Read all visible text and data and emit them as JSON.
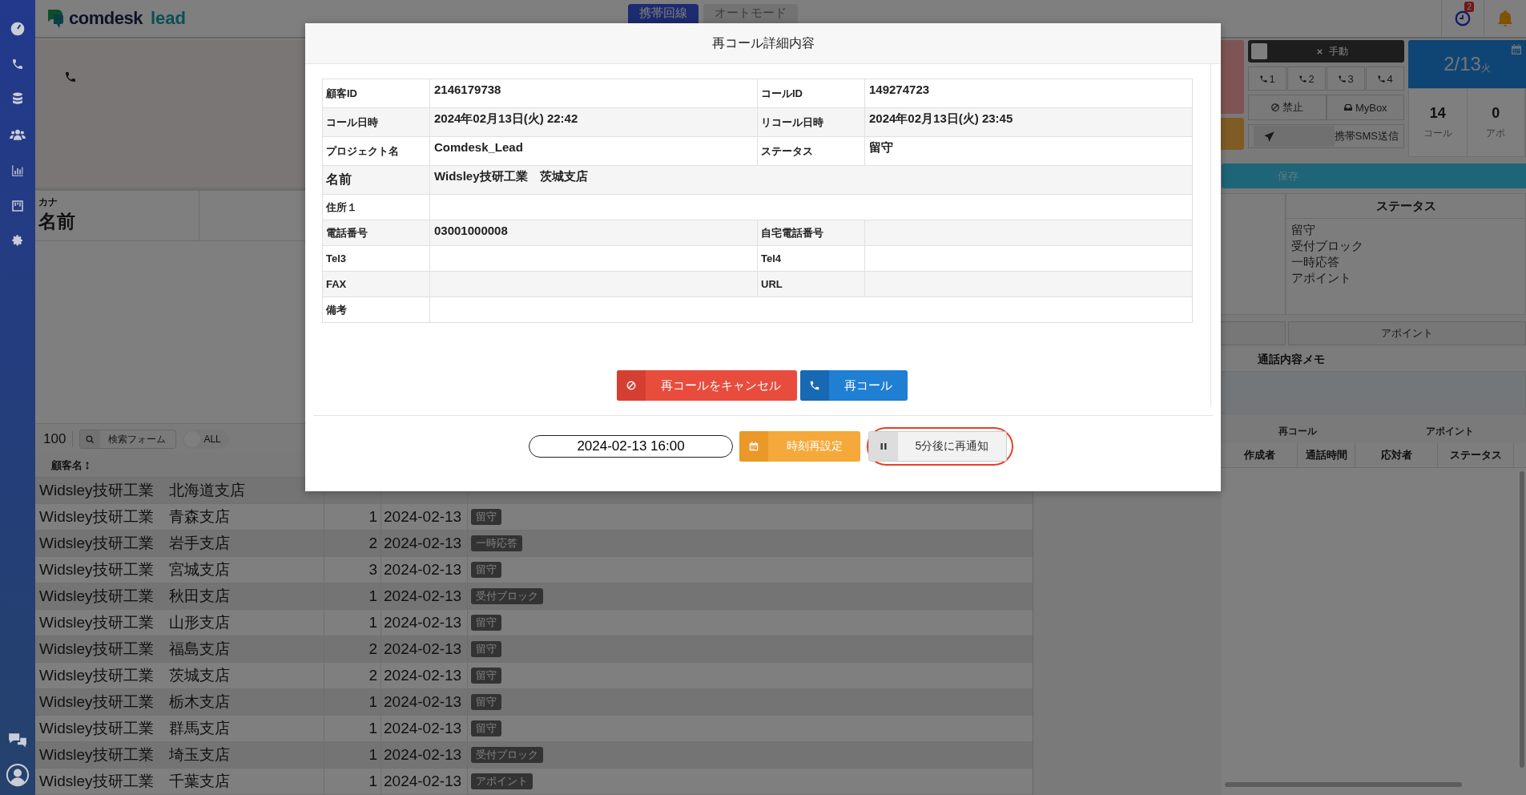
{
  "header": {
    "logo": {
      "brand": "comdesk",
      "product": "lead"
    },
    "tabs": [
      {
        "label": "携帯回線",
        "selected": true
      },
      {
        "label": "オートモード",
        "selected": false
      }
    ],
    "history_badge": "2"
  },
  "contact": {
    "kana_label": "カナ",
    "name_label": "名前"
  },
  "list": {
    "page_size": "100",
    "search_button": "検索フォーム",
    "toggle": {
      "label": "ALL",
      "on": false
    },
    "column": "顧客名",
    "rows": [
      {
        "name": "Widsley技研工業　北海道支店"
      },
      {
        "name": "Widsley技研工業　青森支店",
        "count": "1",
        "date": "2024-02-13",
        "status": "留守"
      },
      {
        "name": "Widsley技研工業　岩手支店",
        "count": "2",
        "date": "2024-02-13",
        "status": "一時応答"
      },
      {
        "name": "Widsley技研工業　宮城支店",
        "count": "3",
        "date": "2024-02-13",
        "status": "留守"
      },
      {
        "name": "Widsley技研工業　秋田支店",
        "count": "1",
        "date": "2024-02-13",
        "status": "受付ブロック"
      },
      {
        "name": "Widsley技研工業　山形支店",
        "count": "1",
        "date": "2024-02-13",
        "status": "留守"
      },
      {
        "name": "Widsley技研工業　福島支店",
        "count": "2",
        "date": "2024-02-13",
        "status": "留守"
      },
      {
        "name": "Widsley技研工業　茨城支店",
        "count": "2",
        "date": "2024-02-13",
        "status": "留守"
      },
      {
        "name": "Widsley技研工業　栃木支店",
        "count": "1",
        "date": "2024-02-13",
        "status": "留守"
      },
      {
        "name": "Widsley技研工業　群馬支店",
        "count": "1",
        "date": "2024-02-13",
        "status": "留守"
      },
      {
        "name": "Widsley技研工業　埼玉支店",
        "count": "1",
        "date": "2024-02-13",
        "status": "受付ブロック"
      },
      {
        "name": "Widsley技研工業　千葉支店",
        "count": "1",
        "date": "2024-02-13",
        "status": "アポイント"
      }
    ]
  },
  "dialer": {
    "mode": {
      "label": "手動",
      "checked": false
    },
    "lines": [
      "1",
      "2",
      "3",
      "4"
    ],
    "block_button": "禁止",
    "mybox_button": "MyBox",
    "sms_button": "携帯SMS送信"
  },
  "today": {
    "date": "2/13",
    "weekday": "火",
    "stats": [
      {
        "value": "14",
        "label": "コール"
      },
      {
        "value": "0",
        "label": "アポ"
      }
    ]
  },
  "save_button": "保存",
  "status_panel": {
    "title": "ステータス",
    "options": [
      "留守",
      "受付ブロック",
      "一時応答",
      "アポイント"
    ]
  },
  "appointment_button": "アポイント",
  "memo": {
    "title": "通話内容メモ"
  },
  "history": {
    "tabs": [
      "再コール",
      "アポイント"
    ],
    "columns": [
      "作成者",
      "通話時間",
      "応対者",
      "ステータス"
    ]
  },
  "dialog": {
    "title": "再コール詳細内容",
    "rows": [
      {
        "cells": [
          {
            "label": "顧客ID",
            "value": "2146179738"
          },
          {
            "label": "コールID",
            "value": "149274723"
          }
        ]
      },
      {
        "cells": [
          {
            "label": "コール日時",
            "value": "2024年02月13日(火) 22:42"
          },
          {
            "label": "リコール日時",
            "value": "2024年02月13日(火) 23:45"
          }
        ]
      },
      {
        "cells": [
          {
            "label": "プロジェクト名",
            "value": "Comdesk_Lead"
          },
          {
            "label": "ステータス",
            "value": "留守"
          }
        ]
      },
      {
        "cells": [
          {
            "label": "名前",
            "value": "Widsley技研工業　茨城支店",
            "large": true
          }
        ]
      },
      {
        "cells": [
          {
            "label": "住所１"
          }
        ]
      },
      {
        "cells": [
          {
            "label": "電話番号",
            "value": "03001000008"
          },
          {
            "label": "自宅電話番号"
          }
        ]
      },
      {
        "cells": [
          {
            "label": "Tel3"
          },
          {
            "label": "Tel4"
          }
        ]
      },
      {
        "cells": [
          {
            "label": "FAX"
          },
          {
            "label": "URL"
          }
        ]
      },
      {
        "cells": [
          {
            "label": "備考"
          }
        ]
      }
    ],
    "actions": [
      {
        "kind": "cancel",
        "label": "再コールをキャンセル"
      },
      {
        "kind": "recall",
        "label": "再コール"
      }
    ],
    "reschedule": {
      "datetime": "2024-02-13 16:00",
      "set_button": "時刻再設定",
      "snooze_button": "5分後に再通知",
      "snooze_highlighted": true
    }
  }
}
